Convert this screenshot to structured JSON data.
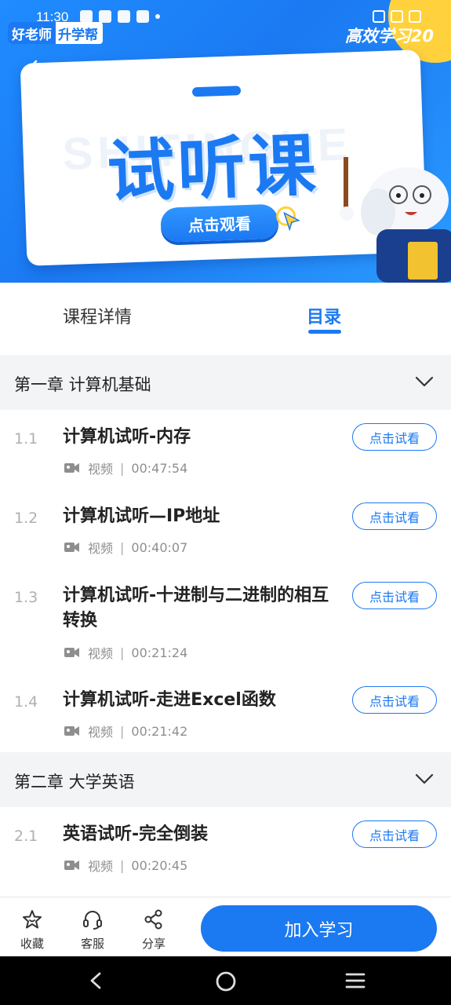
{
  "status_bar": {
    "time": "11:30"
  },
  "banner": {
    "brand_left_a": "好老师",
    "brand_left_b": "升学帮",
    "brand_right": "高效学习20",
    "ghost_text": "SHITINGKE",
    "title": "试听课",
    "cta_label": "点击观看"
  },
  "tabs": {
    "details": "课程详情",
    "catalog": "目录",
    "active": "catalog"
  },
  "chapters": [
    {
      "title": "第一章 计算机基础",
      "lessons": [
        {
          "num": "1.1",
          "name": "计算机试听-内存",
          "type": "视频",
          "duration": "00:47:54",
          "button": "点击试看"
        },
        {
          "num": "1.2",
          "name": "计算机试听—IP地址",
          "type": "视频",
          "duration": "00:40:07",
          "button": "点击试看"
        },
        {
          "num": "1.3",
          "name": "计算机试听-十进制与二进制的相互转换",
          "type": "视频",
          "duration": "00:21:24",
          "button": "点击试看"
        },
        {
          "num": "1.4",
          "name": "计算机试听-走进Excel函数",
          "type": "视频",
          "duration": "00:21:42",
          "button": "点击试看"
        }
      ]
    },
    {
      "title": "第二章 大学英语",
      "lessons": [
        {
          "num": "2.1",
          "name": "英语试听-完全倒装",
          "type": "视频",
          "duration": "00:20:45",
          "button": "点击试看"
        }
      ]
    }
  ],
  "bottom_bar": {
    "favorite": "收藏",
    "service": "客服",
    "share": "分享",
    "join": "加入学习"
  },
  "colors": {
    "accent": "#1b79f2",
    "chapter_bg": "#f3f4f6",
    "muted": "#8e8e8e"
  },
  "icons": {
    "back": "chevron-left-icon",
    "chapter_toggle": "chevron-down-icon",
    "lesson_type": "video-camera-icon",
    "favorite": "star-icon",
    "service": "headset-icon",
    "share": "share-icon",
    "nav_back": "back-triangle-icon",
    "nav_home": "home-circle-icon",
    "nav_menu": "menu-lines-icon"
  }
}
